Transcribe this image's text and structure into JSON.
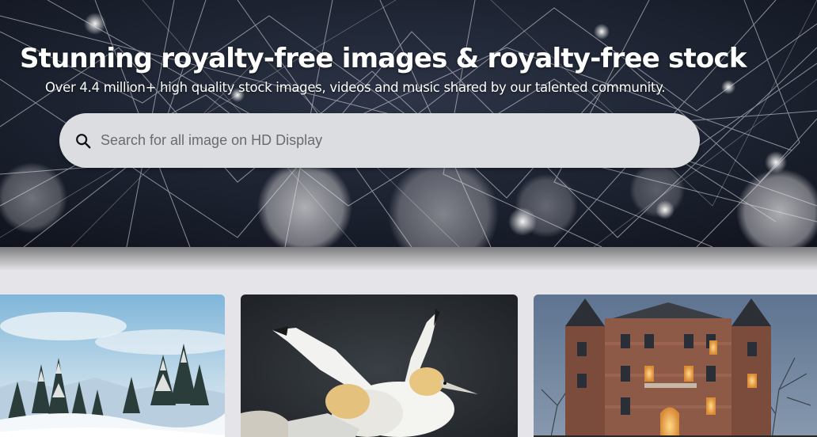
{
  "hero": {
    "title": "Stunning royalty-free images & royalty-free stock",
    "subtitle": "Over 4.4 million+ high quality stock images, videos and music shared by our talented community."
  },
  "search": {
    "placeholder": "Search for all image on HD Display",
    "value": "",
    "icon": "search-icon"
  },
  "gallery": {
    "items": [
      {
        "subject": "snowy-forest-photo"
      },
      {
        "subject": "gannets-photo"
      },
      {
        "subject": "castle-photo"
      }
    ]
  },
  "colors": {
    "hero_background": "#1a2030",
    "search_background": "#dcdde1",
    "page_background": "#e5e5e9",
    "title_text": "#ffffff"
  }
}
